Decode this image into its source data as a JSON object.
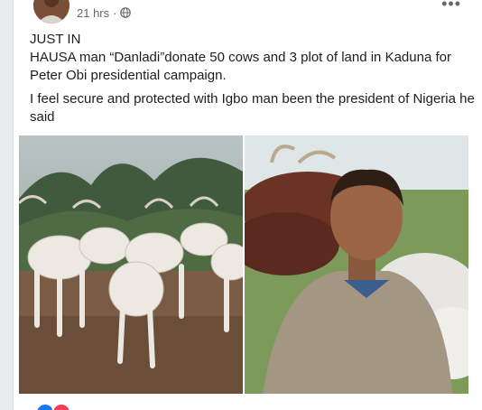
{
  "post": {
    "timestamp": "21 hrs",
    "separator": "·",
    "audience_icon": "globe-icon",
    "more_icon": "more-options-icon",
    "lines": [
      "JUST IN",
      "HAUSA man “Danladi”donate 50 cows and 3 plot of land in Kaduna for Peter Obi presidential campaign.",
      "I feel secure and protected with Igbo man been the president of Nigeria he said"
    ],
    "photos": [
      "cattle-herd-photo",
      "young-man-with-cattle-photo"
    ],
    "reactions": [
      "like-reaction-icon",
      "love-reaction-icon"
    ]
  },
  "colors": {
    "text": "#1c1e21",
    "secondary_text": "#65676b",
    "like": "#1877f2",
    "love": "#f33e58"
  }
}
